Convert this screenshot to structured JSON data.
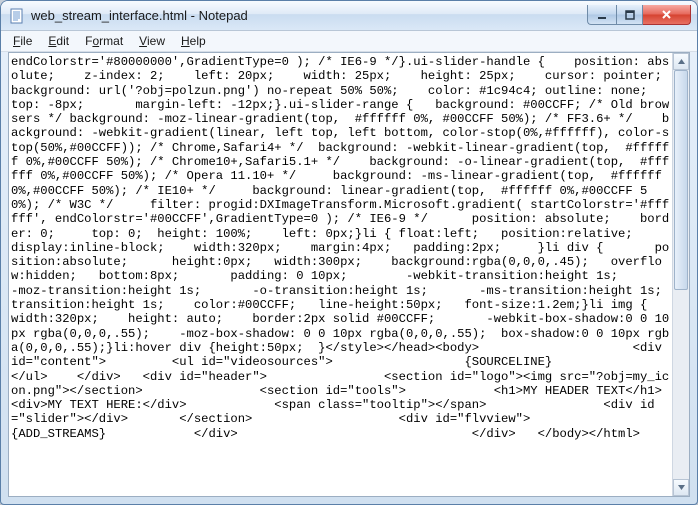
{
  "window": {
    "title": "web_stream_interface.html - Notepad"
  },
  "menu": {
    "file": "File",
    "edit": "Edit",
    "format": "Format",
    "view": "View",
    "help": "Help"
  },
  "icons": {
    "minimize": "minimize-icon",
    "maximize": "maximize-icon",
    "close": "close-icon",
    "scroll_up": "chevron-up-icon",
    "scroll_down": "chevron-down-icon"
  },
  "editor": {
    "text": "endColorstr='#80000000',GradientType=0 ); /* IE6-9 */}.ui-slider-handle {    position: absolute;    z-index: 2;    left: 20px;    width: 25px;    height: 25px;    cursor: pointer;       background: url('?obj=polzun.png') no-repeat 50% 50%;    color: #1c94c4; outline: none;    top: -8px;       margin-left: -12px;}.ui-slider-range {   background: #00CCFF; /* Old browsers */ background: -moz-linear-gradient(top,  #ffffff 0%, #00CCFF 50%); /* FF3.6+ */    background: -webkit-gradient(linear, left top, left bottom, color-stop(0%,#ffffff), color-stop(50%,#00CCFF)); /* Chrome,Safari4+ */  background: -webkit-linear-gradient(top,  #ffffff 0%,#00CCFF 50%); /* Chrome10+,Safari5.1+ */    background: -o-linear-gradient(top,  #ffffff 0%,#00CCFF 50%); /* Opera 11.10+ */     background: -ms-linear-gradient(top,  #ffffff 0%,#00CCFF 50%); /* IE10+ */     background: linear-gradient(top,  #ffffff 0%,#00CCFF 50%); /* W3C */     filter: progid:DXImageTransform.Microsoft.gradient( startColorstr='#ffffff', endColorstr='#00CCFF',GradientType=0 ); /* IE6-9 */      position: absolute;    border: 0;     top: 0;  height: 100%;    left: 0px;}li { float:left;   position:relative;      display:inline-block;    width:320px;    margin:4px;   padding:2px;     }li div {       position:absolute;      height:0px;   width:300px;    background:rgba(0,0,0,.45);   overflow:hidden;   bottom:8px;       padding: 0 10px;        -webkit-transition:height 1s;       -moz-transition:height 1s;       -o-transition:height 1s;       -ms-transition:height 1s;    transition:height 1s;    color:#00CCFF;   line-height:50px;   font-size:1.2em;}li img {       width:320px;    height: auto;    border:2px solid #00CCFF;       -webkit-box-shadow:0 0 10px rgba(0,0,0,.55);    -moz-box-shadow: 0 0 10px rgba(0,0,0,.55);  box-shadow:0 0 10px rgba(0,0,0,.55);}li:hover div {height:50px;  }</style></head><body>                     <div id=\"content\">         <ul id=\"videosources\">                  {SOURCELINE}                </ul>    </div>   <div id=\"header\">                <section id=\"logo\"><img src=\"?obj=my_icon.png\"></section>                <section id=\"tools\">            <h1>MY HEADER TEXT</h1>                 <div>MY TEXT HERE:</div>            <span class=\"tooltip\"></span>                <div id=\"slider\"></div>       </section>                    <div id=\"flvview\">                                {ADD_STREAMS}            </div>                                </div>   </body></html>"
  }
}
